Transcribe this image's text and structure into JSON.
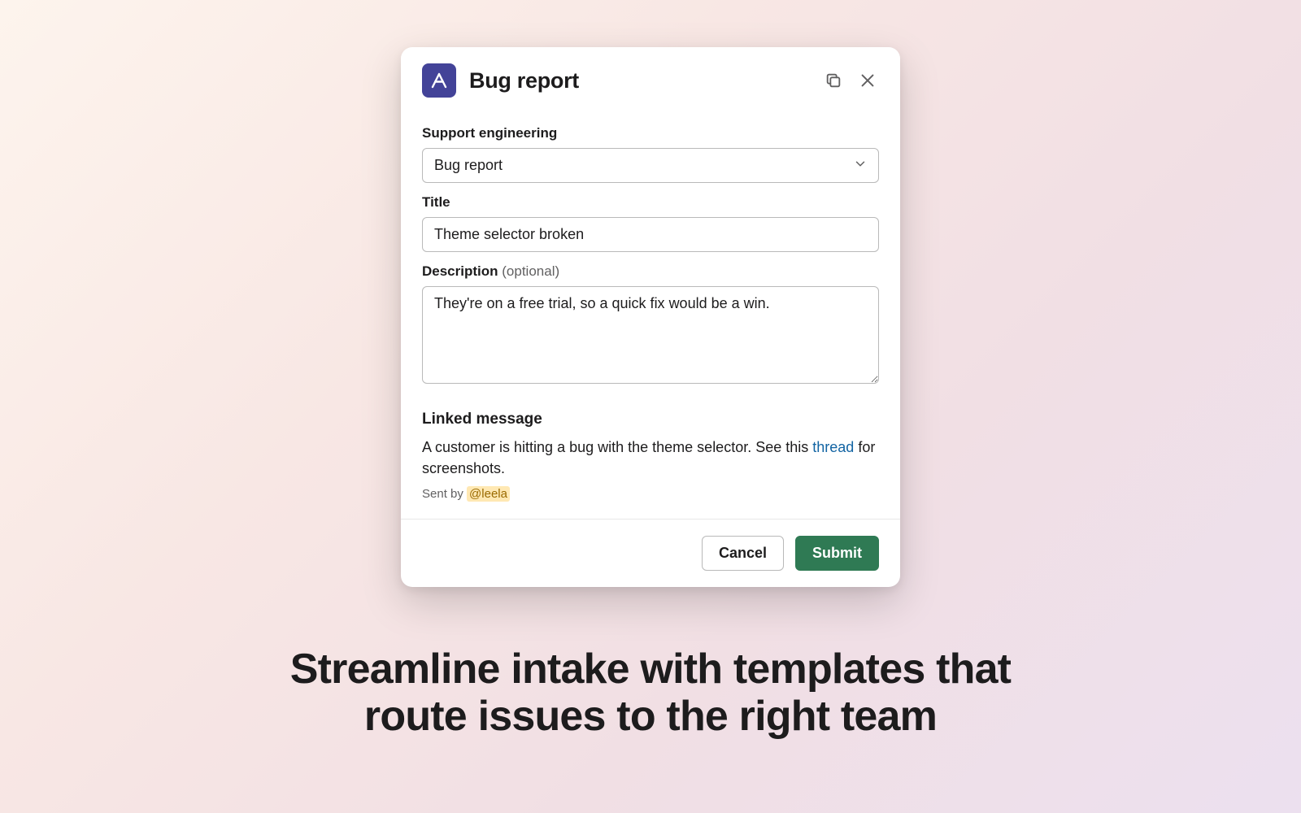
{
  "modal": {
    "title": "Bug report",
    "fields": {
      "category_label": "Support engineering",
      "category_value": "Bug report",
      "title_label": "Title",
      "title_value": "Theme selector broken",
      "description_label": "Description",
      "description_optional": "(optional)",
      "description_value": "They're on a free trial, so a quick fix would be a win."
    },
    "linked": {
      "heading": "Linked message",
      "text_before": "A customer is hitting a bug with the theme selector. See this ",
      "link_text": "thread",
      "text_after": " for screenshots.",
      "sent_by_label": "Sent by ",
      "sent_by_user": "@leela"
    },
    "footer": {
      "cancel": "Cancel",
      "submit": "Submit"
    }
  },
  "headline": "Streamline intake with templates that route issues to the right team"
}
